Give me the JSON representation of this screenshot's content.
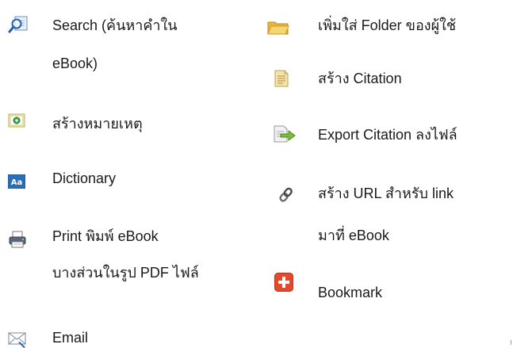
{
  "left_column": [
    {
      "icon": "search-ebook-icon",
      "lines": [
        "Search (ค้นหาคำใน",
        "eBook)"
      ]
    },
    {
      "icon": "create-note-icon",
      "lines": [
        "สร้างหมายเหตุ"
      ]
    },
    {
      "icon": "dictionary-icon",
      "lines": [
        "Dictionary"
      ]
    },
    {
      "icon": "print-icon",
      "lines": [
        "Print พิมพ์ eBook",
        "บางส่วนในรูป PDF ไฟล์"
      ]
    },
    {
      "icon": "email-icon",
      "lines": [
        "Email"
      ]
    }
  ],
  "right_column": [
    {
      "icon": "folder-icon",
      "lines": [
        "เพิ่มใส่ Folder ของผู้ใช้"
      ]
    },
    {
      "icon": "citation-icon",
      "lines": [
        "สร้าง Citation"
      ]
    },
    {
      "icon": "export-citation-icon",
      "lines": [
        "Export Citation ลงไฟล์"
      ]
    },
    {
      "icon": "link-icon",
      "lines": [
        "สร้าง URL  สำหรับ link",
        "มาที่ eBook"
      ]
    },
    {
      "icon": "bookmark-icon",
      "lines": [
        "Bookmark"
      ]
    }
  ],
  "colors": {
    "text": "#1a1a1a",
    "bookmark": "#e24a2b",
    "folder": "#f2c94c",
    "dictionary": "#2a6fb5"
  }
}
